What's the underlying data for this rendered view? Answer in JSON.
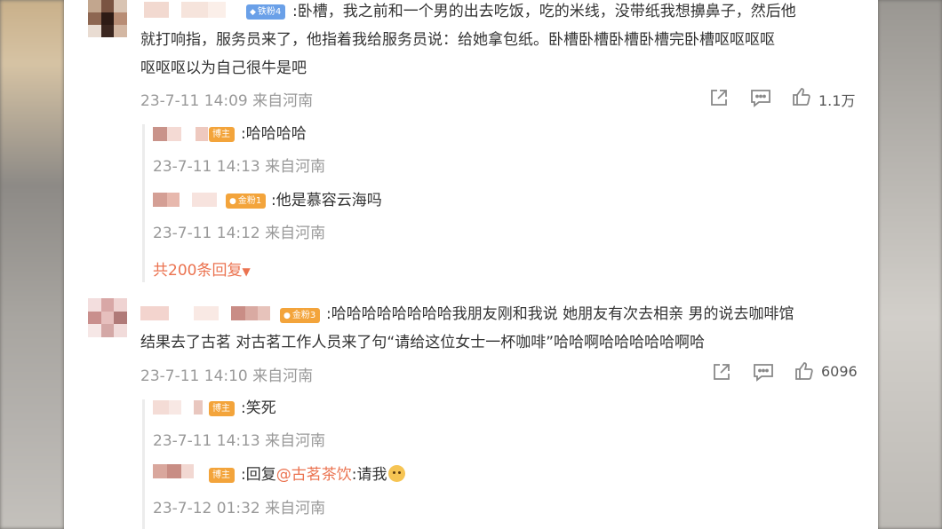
{
  "colors": {
    "mention": "#eb7350",
    "meta": "#999999",
    "text": "#333333",
    "badge_blue": "#6aa0e8",
    "badge_orange": "#f3a43b"
  },
  "comments": [
    {
      "badge": "铁粉4",
      "line1": ":卧槽，我之前和一个男的出去吃饭，吃的米线，没带纸我想擤鼻子，然后他",
      "line2": "就打响指，服务员来了，他指着我给服务员说：给她拿包纸。卧槽卧槽卧槽卧槽完卧槽呕呕呕呕",
      "line3": "呕呕呕以为自己很牛是吧",
      "meta": "23-7-11 14:09 来自河南",
      "likes": "1.1万",
      "replies": [
        {
          "badge": "博主",
          "text": ":哈哈哈哈",
          "meta": "23-7-11 14:13 来自河南"
        },
        {
          "badge": "金粉1",
          "text": ":他是慕容云海吗",
          "meta": "23-7-11 14:12 来自河南"
        }
      ],
      "more": "共200条回复"
    },
    {
      "badge": "金粉3",
      "line1": ":哈哈哈哈哈哈哈哈我朋友刚和我说 她朋友有次去相亲 男的说去咖啡馆",
      "line2": "结果去了古茗 对古茗工作人员来了句“请给这位女士一杯咖啡”哈哈啊哈哈哈哈哈啊哈",
      "meta": "23-7-11 14:10 来自河南",
      "likes": "6096",
      "replies": [
        {
          "badge": "博主",
          "text": ":笑死",
          "meta": "23-7-11 14:13 来自河南"
        },
        {
          "badge": "博主",
          "prefix": ":回复",
          "mention": "@古茗茶饮",
          "suffix": ":请我",
          "emoji": "doge-emoji",
          "meta": "23-7-12 01:32 来自河南"
        }
      ]
    }
  ]
}
